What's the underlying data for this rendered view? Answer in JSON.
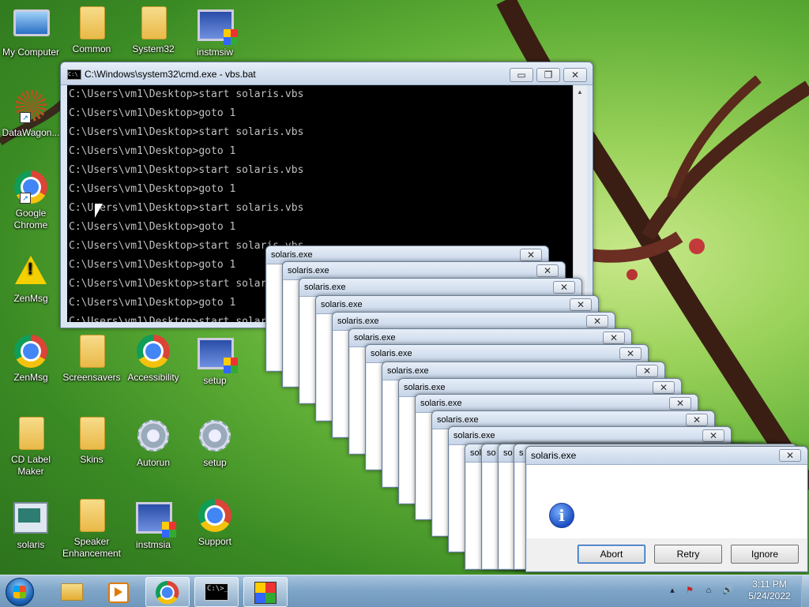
{
  "desktop": {
    "icons": [
      {
        "label": "My Computer"
      },
      {
        "label": "Common"
      },
      {
        "label": "System32"
      },
      {
        "label": "instmsiw"
      },
      {
        "label": "DataWagon..."
      },
      {
        "label": "Google Chrome"
      },
      {
        "label": "ZenMsg"
      },
      {
        "label": "ZenMsg"
      },
      {
        "label": "Screensavers"
      },
      {
        "label": "Accessibility"
      },
      {
        "label": "setup"
      },
      {
        "label": "CD Label Maker"
      },
      {
        "label": "Skins"
      },
      {
        "label": "Autorun"
      },
      {
        "label": "setup"
      },
      {
        "label": "solaris"
      },
      {
        "label": "Speaker Enhancement"
      },
      {
        "label": "instmsia"
      },
      {
        "label": "Support"
      }
    ]
  },
  "cmd_window": {
    "icon_text": "C:\\",
    "title": "C:\\Windows\\system32\\cmd.exe - vbs.bat",
    "minimize": "▭",
    "maximize": "❐",
    "close": "✕",
    "lines": [
      "C:\\Users\\vm1\\Desktop>start solaris.vbs",
      "C:\\Users\\vm1\\Desktop>goto 1",
      "C:\\Users\\vm1\\Desktop>start solaris.vbs",
      "C:\\Users\\vm1\\Desktop>goto 1",
      "C:\\Users\\vm1\\Desktop>start solaris.vbs",
      "C:\\Users\\vm1\\Desktop>goto 1",
      "C:\\Users\\vm1\\Desktop>start solaris.vbs",
      "C:\\Users\\vm1\\Desktop>goto 1",
      "C:\\Users\\vm1\\Desktop>start solaris.vbs",
      "C:\\Users\\vm1\\Desktop>goto 1",
      "C:\\Users\\vm1\\Desktop>start solaris.vbs",
      "C:\\Users\\vm1\\Desktop>goto 1",
      "C:\\Users\\vm1\\Desktop>start solaris.vbs"
    ]
  },
  "dialogs": {
    "title": "solaris.exe",
    "short_titles": [
      "sol",
      "so",
      "so",
      "s"
    ],
    "close": "✕"
  },
  "message_box": {
    "title": "solaris.exe",
    "icon": "info-icon",
    "close": "✕",
    "buttons": {
      "abort": "Abort",
      "retry": "Retry",
      "ignore": "Ignore"
    }
  },
  "taskbar": {
    "cmd_icon_text": "C:\\>_",
    "tray_icons": [
      "▴",
      "⚑",
      "⌂",
      "🔊"
    ],
    "clock": {
      "time": "3:11 PM",
      "date": "5/24/2022"
    }
  }
}
